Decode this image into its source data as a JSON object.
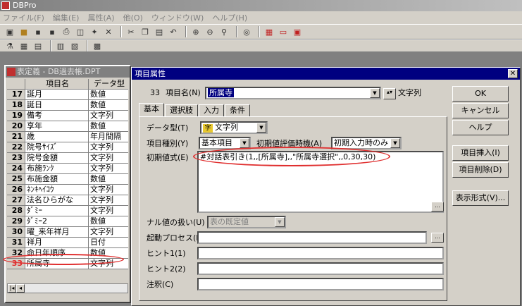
{
  "app": {
    "title": "DBPro"
  },
  "menu": [
    "ファイル(F)",
    "編集(E)",
    "属性(A)",
    "他(O)",
    "ウィンドウ(W)",
    "ヘルプ(H)"
  ],
  "child": {
    "title": "表定義 - DB過去帳.DPT",
    "col_name": "項目名",
    "col_type": "データ型",
    "rows": [
      {
        "num": "17",
        "name": "誕月",
        "type": "数値"
      },
      {
        "num": "18",
        "name": "誕日",
        "type": "数値"
      },
      {
        "num": "19",
        "name": "備考",
        "type": "文字列"
      },
      {
        "num": "20",
        "name": "享年",
        "type": "数値"
      },
      {
        "num": "21",
        "name": "歳",
        "type": "年月間隔"
      },
      {
        "num": "22",
        "name": "院号ｻｲｽﾞ",
        "type": "文字列"
      },
      {
        "num": "23",
        "name": "院号金額",
        "type": "文字列"
      },
      {
        "num": "24",
        "name": "布施ﾗﾝｸ",
        "type": "文字列"
      },
      {
        "num": "25",
        "name": "布施金額",
        "type": "数値"
      },
      {
        "num": "26",
        "name": "ﾈﾝｷﾍｲｺｳ",
        "type": "文字列"
      },
      {
        "num": "27",
        "name": "法名ひらがな",
        "type": "文字列"
      },
      {
        "num": "28",
        "name": "ﾀﾞﾐｰ",
        "type": "文字列"
      },
      {
        "num": "29",
        "name": "ﾀﾞﾐｰ2",
        "type": "数値"
      },
      {
        "num": "30",
        "name": "曜_来年祥月",
        "type": "文字列"
      },
      {
        "num": "31",
        "name": "祥月",
        "type": "日付"
      },
      {
        "num": "32",
        "name": "命日年順序",
        "type": "数値"
      },
      {
        "num": "33",
        "name": "所属寺",
        "type": "文字列"
      }
    ]
  },
  "dialog": {
    "title": "項目属性",
    "item_no": "33",
    "item_name_label": "項目名(N)",
    "item_name_value": "所属寺",
    "type_display": "文字列",
    "tabs": [
      "基本",
      "選択肢",
      "入力",
      "条件"
    ],
    "datatype_label": "データ型(T)",
    "datatype_icon": "字",
    "datatype_value": "文字列",
    "kind_label": "項目種別(Y)",
    "kind_value": "基本項目",
    "eval_label": "初期値評価時機(A)",
    "eval_value": "初期入力時のみ",
    "initexpr_label": "初期値式(E)",
    "initexpr_value": "#対話表引き(1,,[所属寺],,\"所属寺選択\",,0,30,30)",
    "null_label": "ナル値の扱い(U)",
    "null_value": "表の既定値",
    "proc_label": "起動プロセス(P)",
    "hint1_label": "ヒント1(1)",
    "hint2_label": "ヒント2(2)",
    "note_label": "注釈(C)",
    "buttons": {
      "ok": "OK",
      "cancel": "キャンセル",
      "help": "ヘルプ",
      "insert": "項目挿入(I)",
      "delete": "項目削除(D)",
      "display": "表示形式(V)..."
    }
  },
  "colors": {
    "highlight": "#e03030",
    "title_active": "#000080"
  }
}
